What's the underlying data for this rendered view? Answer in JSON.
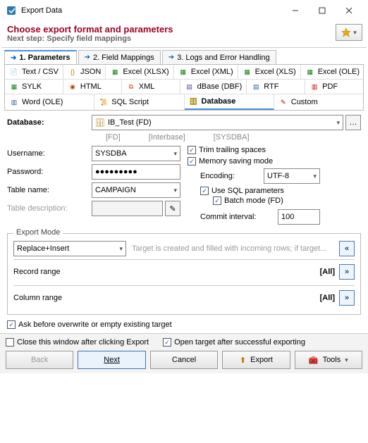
{
  "window": {
    "title": "Export Data"
  },
  "header": {
    "title": "Choose export format and parameters",
    "subtitle": "Next step: Specify field mappings"
  },
  "steps": {
    "s1": "1. Parameters",
    "s2": "2. Field Mappings",
    "s3": "3. Logs and Error Handling"
  },
  "formats": {
    "text": "Text / CSV",
    "json": "JSON",
    "xlsx": "Excel (XLSX)",
    "xml_x": "Excel (XML)",
    "xls": "Excel (XLS)",
    "ole": "Excel (OLE)",
    "sylk": "SYLK",
    "html": "HTML",
    "xml": "XML",
    "dbf": "dBase (DBF)",
    "rtf": "RTF",
    "pdf": "PDF",
    "word": "Word (OLE)",
    "sql": "SQL Script",
    "database": "Database",
    "custom": "Custom"
  },
  "fields": {
    "database_label": "Database:",
    "database_value": "IB_Test (FD)",
    "meta_fd": "[FD]",
    "meta_ib": "[Interbase]",
    "meta_sys": "[SYSDBA]",
    "username_label": "Username:",
    "username_value": "SYSDBA",
    "password_label": "Password:",
    "password_value": "●●●●●●●●●",
    "table_label": "Table name:",
    "table_value": "CAMPAIGN",
    "desc_label": "Table description:",
    "desc_value": ""
  },
  "opts": {
    "trim": "Trim trailing spaces",
    "memory": "Memory saving mode",
    "encoding_label": "Encoding:",
    "encoding_value": "UTF-8",
    "sqlparams": "Use SQL parameters",
    "batch": "Batch mode (FD)",
    "commit_label": "Commit interval:",
    "commit_value": "100"
  },
  "export_mode": {
    "label": "Export Mode",
    "value": "Replace+Insert",
    "hint": "Target is created and filled with incoming rows; if target..."
  },
  "ranges": {
    "record_label": "Record range",
    "record_value": "[All]",
    "column_label": "Column range",
    "column_value": "[All]"
  },
  "ask_overwrite": "Ask before overwrite or empty existing target",
  "footer": {
    "close_after": "Close this window after clicking Export",
    "open_after": "Open target after successful exporting",
    "back": "Back",
    "next": "Next",
    "cancel": "Cancel",
    "export": "Export",
    "tools": "Tools"
  }
}
